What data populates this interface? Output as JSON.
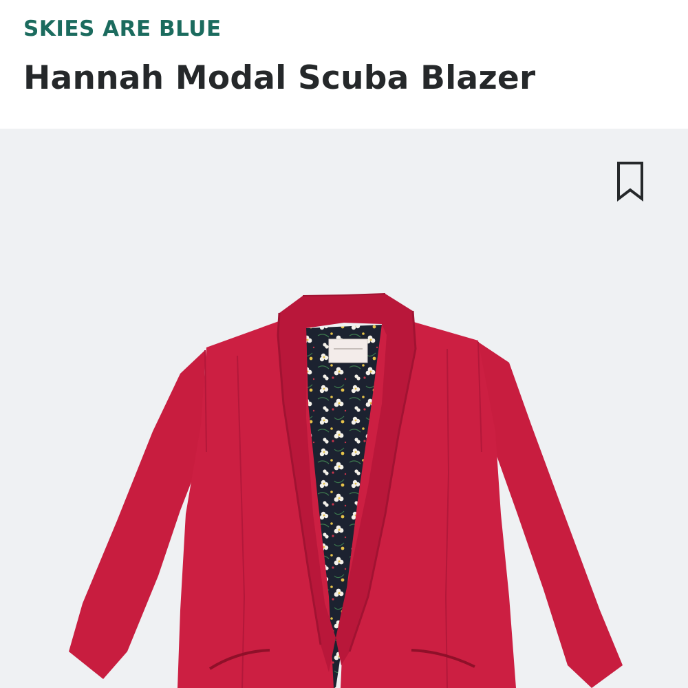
{
  "header": {
    "brand": "SKIES ARE BLUE",
    "title": "Hannah Modal Scuba Blazer"
  },
  "colors": {
    "brand": "#1b6b5e",
    "title": "#25282a",
    "image_background": "#eff1f3",
    "blazer": "#c81d3f",
    "lining": "#1c2230"
  },
  "icons": {
    "save": "bookmark-icon"
  }
}
